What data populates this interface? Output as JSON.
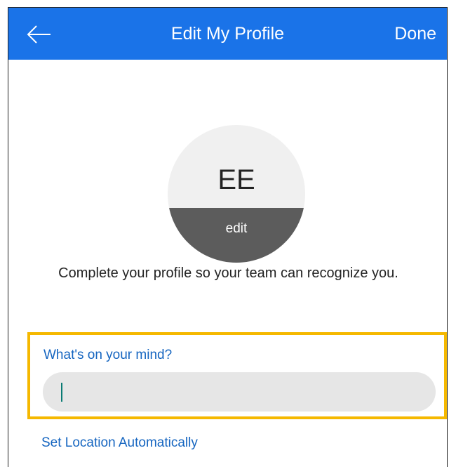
{
  "header": {
    "title": "Edit My Profile",
    "done_label": "Done",
    "back_icon": "arrow-left-icon",
    "background_color": "#1a73e8"
  },
  "avatar": {
    "initials": "EE",
    "edit_label": "edit"
  },
  "prompt": "Complete your profile so your team can recognize you.",
  "status_field": {
    "label": "What's on your mind?",
    "value": "",
    "highlight_color": "#f5b800"
  },
  "location_link": "Set Location Automatically"
}
